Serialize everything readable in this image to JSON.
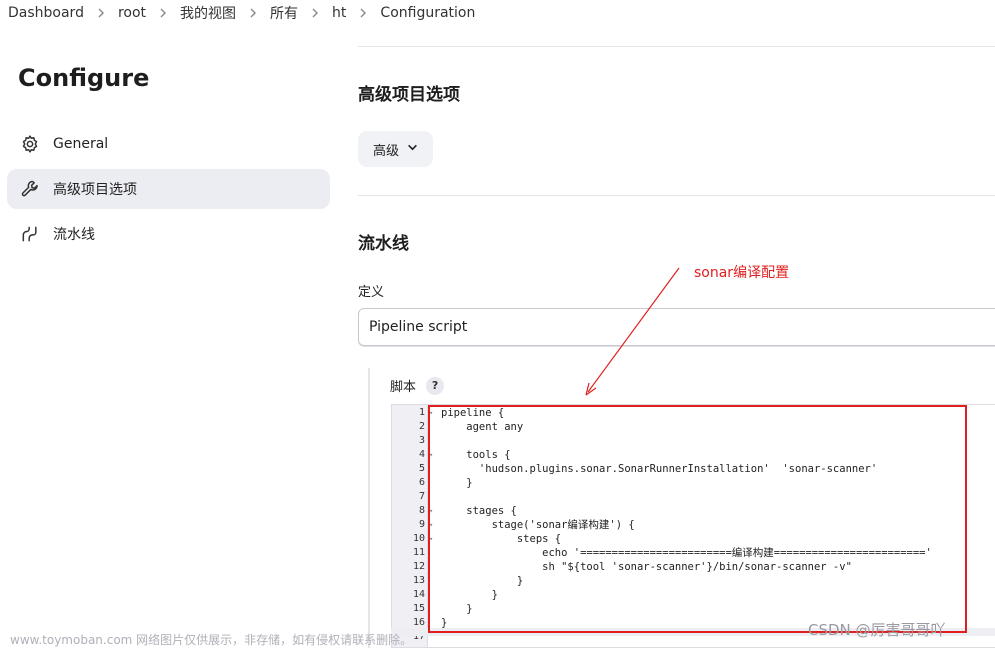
{
  "breadcrumb": [
    "Dashboard",
    "root",
    "我的视图",
    "所有",
    "ht",
    "Configuration"
  ],
  "sidebar": {
    "title": "Configure",
    "items": [
      {
        "label": "General",
        "icon": "gear-icon",
        "active": false
      },
      {
        "label": "高级项目选项",
        "icon": "wrench-icon",
        "active": true
      },
      {
        "label": "流水线",
        "icon": "pipeline-icon",
        "active": false
      }
    ]
  },
  "advanced": {
    "title": "高级项目选项",
    "button_label": "高级"
  },
  "pipeline": {
    "title": "流水线",
    "definition_label": "定义",
    "definition_value": "Pipeline script",
    "script_label": "脚本",
    "help_label": "?"
  },
  "code": [
    {
      "n": "1",
      "fold": true,
      "text": "pipeline {"
    },
    {
      "n": "2",
      "fold": false,
      "text": "    agent any"
    },
    {
      "n": "3",
      "fold": false,
      "text": ""
    },
    {
      "n": "4",
      "fold": true,
      "text": "    tools {"
    },
    {
      "n": "5",
      "fold": false,
      "text": "      'hudson.plugins.sonar.SonarRunnerInstallation'  'sonar-scanner'"
    },
    {
      "n": "6",
      "fold": false,
      "text": "    }"
    },
    {
      "n": "7",
      "fold": false,
      "text": ""
    },
    {
      "n": "8",
      "fold": true,
      "text": "    stages {"
    },
    {
      "n": "9",
      "fold": true,
      "text": "        stage('sonar编译构建') {"
    },
    {
      "n": "10",
      "fold": true,
      "text": "            steps {"
    },
    {
      "n": "11",
      "fold": false,
      "text": "                echo '========================编译构建========================'"
    },
    {
      "n": "12",
      "fold": false,
      "text": "                sh \"${tool 'sonar-scanner'}/bin/sonar-scanner -v\""
    },
    {
      "n": "13",
      "fold": false,
      "text": "            }"
    },
    {
      "n": "14",
      "fold": false,
      "text": "        }"
    },
    {
      "n": "15",
      "fold": false,
      "text": "    }"
    },
    {
      "n": "16",
      "fold": false,
      "text": "}"
    },
    {
      "n": "17",
      "fold": false,
      "text": ""
    }
  ],
  "annotation": {
    "label": "sonar编译配置",
    "color": "#e02020"
  },
  "watermarks": {
    "left": "www.toymoban.com 网络图片仅供展示，非存储，如有侵权请联系删除。",
    "right": "CSDN @厉害哥哥吖"
  }
}
